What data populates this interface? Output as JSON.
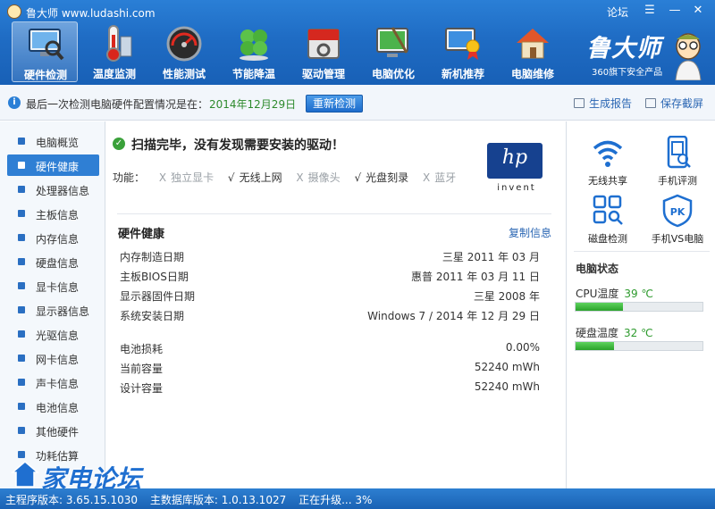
{
  "window": {
    "title": "鲁大师 www.ludashi.com",
    "forum_link": "论坛",
    "controls": {
      "menu": "☰",
      "minimize": "—",
      "close": "✕"
    }
  },
  "toolbar": {
    "items": [
      {
        "label": "硬件检测",
        "icon": "monitor-magnifier-icon",
        "active": true
      },
      {
        "label": "温度监测",
        "icon": "thermometer-icon",
        "active": false
      },
      {
        "label": "性能测试",
        "icon": "speedometer-icon",
        "active": false
      },
      {
        "label": "节能降温",
        "icon": "clover-icon",
        "active": false
      },
      {
        "label": "驱动管理",
        "icon": "driver-box-icon",
        "active": false
      },
      {
        "label": "电脑优化",
        "icon": "broom-screen-icon",
        "active": false
      },
      {
        "label": "新机推荐",
        "icon": "monitor-medal-icon",
        "active": false
      },
      {
        "label": "电脑维修",
        "icon": "house-icon",
        "active": false
      }
    ]
  },
  "brand": {
    "name": "鲁大师",
    "tagline": "360旗下安全产品"
  },
  "status": {
    "prefix": "最后一次检测电脑硬件配置情况是在：",
    "date": "2014年12月29日",
    "recheck": "重新检测",
    "report": "生成报告",
    "screenshot": "保存截屏"
  },
  "sidebar": {
    "items": [
      {
        "label": "电脑概览",
        "active": false
      },
      {
        "label": "硬件健康",
        "active": true
      },
      {
        "label": "处理器信息",
        "active": false
      },
      {
        "label": "主板信息",
        "active": false
      },
      {
        "label": "内存信息",
        "active": false
      },
      {
        "label": "硬盘信息",
        "active": false
      },
      {
        "label": "显卡信息",
        "active": false
      },
      {
        "label": "显示器信息",
        "active": false
      },
      {
        "label": "光驱信息",
        "active": false
      },
      {
        "label": "网卡信息",
        "active": false
      },
      {
        "label": "声卡信息",
        "active": false
      },
      {
        "label": "电池信息",
        "active": false
      },
      {
        "label": "其他硬件",
        "active": false
      },
      {
        "label": "功耗估算",
        "active": false
      }
    ]
  },
  "main": {
    "scan_message": "扫描完毕，没有发现需要安装的驱动！",
    "features_label": "功能：",
    "features": [
      {
        "label": "独立显卡",
        "available": false,
        "mark": "X"
      },
      {
        "label": "无线上网",
        "available": true,
        "mark": "√"
      },
      {
        "label": "摄像头",
        "available": false,
        "mark": "X"
      },
      {
        "label": "光盘刻录",
        "available": true,
        "mark": "√"
      },
      {
        "label": "蓝牙",
        "available": false,
        "mark": "X"
      }
    ],
    "vendor_logo": {
      "mark": "hp",
      "word": "invent"
    },
    "section_title": "硬件健康",
    "copy_link": "复制信息",
    "health_rows": [
      {
        "key": "内存制造日期",
        "value": "三星 2011 年 03 月"
      },
      {
        "key": "主板BIOS日期",
        "value": "惠普 2011 年 03 月 11 日"
      },
      {
        "key": "显示器固件日期",
        "value": "三星 2008 年"
      },
      {
        "key": "系统安装日期",
        "value": "Windows 7 / 2014 年 12 月 29 日"
      }
    ],
    "battery_rows": [
      {
        "key": "电池损耗",
        "value": "0.00%"
      },
      {
        "key": "当前容量",
        "value": "52240 mWh"
      },
      {
        "key": "设计容量",
        "value": "52240 mWh"
      }
    ]
  },
  "right_panel": {
    "tiles": [
      {
        "label": "无线共享",
        "icon": "wifi-icon"
      },
      {
        "label": "手机评测",
        "icon": "phone-scan-icon"
      },
      {
        "label": "磁盘检测",
        "icon": "disk-check-icon"
      },
      {
        "label": "手机VS电脑",
        "icon": "pk-shield-icon"
      }
    ],
    "status_title": "电脑状态",
    "temps": [
      {
        "label": "CPU温度",
        "value": "39 ℃",
        "level": 0.37
      },
      {
        "label": "硬盘温度",
        "value": "32 ℃",
        "level": 0.3
      }
    ]
  },
  "bottom": {
    "main_version": "主程序版本: 3.65.15.1030",
    "db_version": "主数据库版本: 1.0.13.1027",
    "upgrade": "正在升级... 3%"
  },
  "watermark": {
    "text": "家电论坛"
  },
  "colors": {
    "accent": "#1f6cc4",
    "ok": "#2d9a2d",
    "link": "#2a66b3"
  }
}
